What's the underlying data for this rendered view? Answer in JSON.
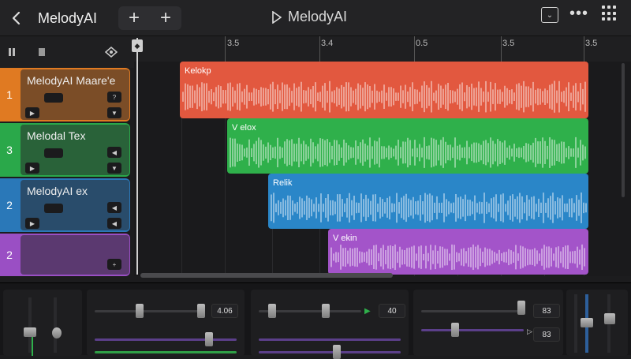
{
  "app": {
    "title": "MelodyAI"
  },
  "transport": {
    "title": "MelodyAI"
  },
  "ruler": {
    "labels": [
      "3.5",
      "3.4",
      "0.5",
      "3.5",
      "3.5"
    ]
  },
  "tracks": [
    {
      "number": "1",
      "name": "MelodyAI Maare'e",
      "color": "#e07a22"
    },
    {
      "number": "3",
      "name": "Melodal Tex",
      "color": "#2aa84a"
    },
    {
      "number": "2",
      "name": "MelodyAI ex",
      "color": "#2a78b8"
    },
    {
      "number": "2",
      "name": "",
      "color": "#9a4fc4"
    }
  ],
  "clips": [
    {
      "label": "Kelokp",
      "color": "#e2583f"
    },
    {
      "label": "V elox",
      "color": "#2fb04b"
    },
    {
      "label": "Relik",
      "color": "#2a86c8"
    },
    {
      "label": "V ekin",
      "color": "#a354c9"
    }
  ],
  "mixer": {
    "values": [
      "4.06",
      "40",
      "83",
      "83"
    ]
  },
  "icons": {
    "back": "chevron-left-icon",
    "add": "plus-icon",
    "play": "play-icon",
    "pause": "pause-icon",
    "more": "more-dots-icon",
    "grid": "grid-icon"
  }
}
